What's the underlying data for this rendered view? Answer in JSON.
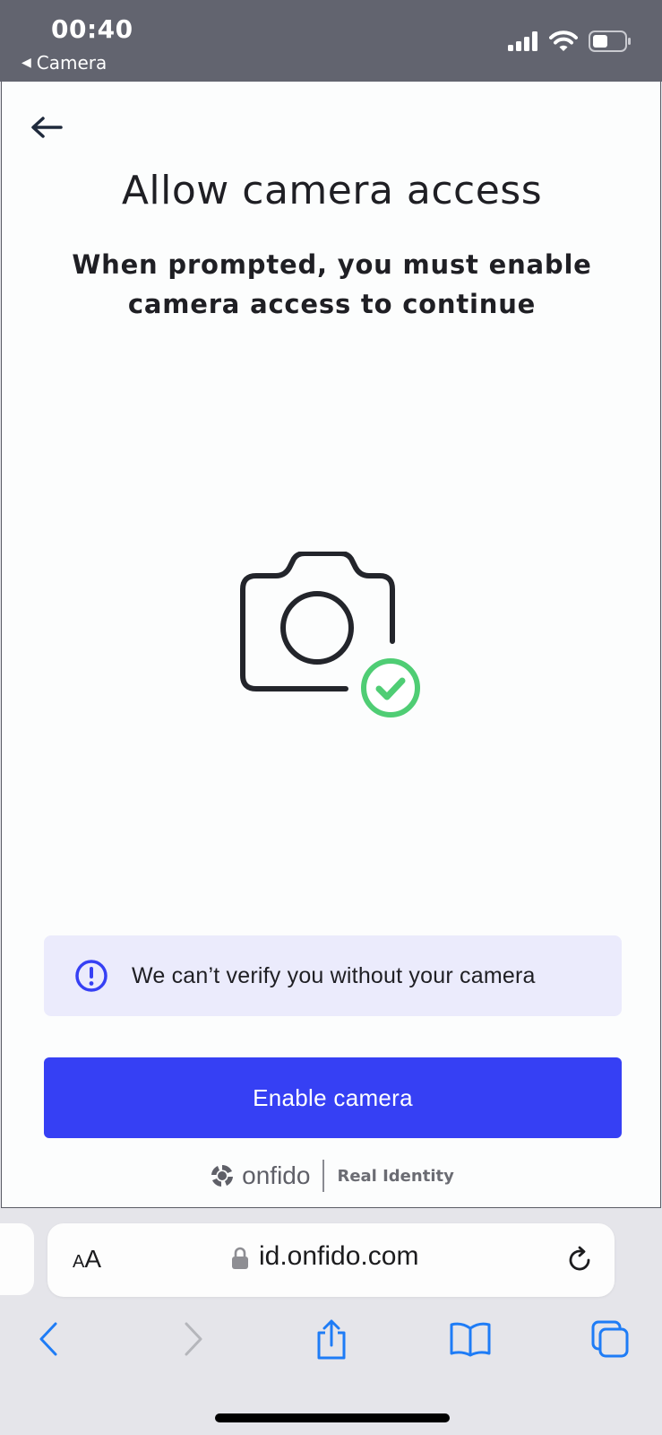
{
  "status_bar": {
    "time": "00:40",
    "back_app": "Camera",
    "icons": [
      "signal-icon",
      "wifi-icon",
      "battery-icon"
    ]
  },
  "page": {
    "title": "Allow camera access",
    "subtitle": "When prompted, you must enable camera access to continue",
    "notice": "We can’t verify you without your camera",
    "button": "Enable camera",
    "brand_name": "onfido",
    "brand_tagline": "Real Identity"
  },
  "browser": {
    "text_size_small": "A",
    "text_size_large": "A",
    "url": "id.onfido.com"
  },
  "colors": {
    "accent": "#3640f4",
    "success": "#4fcd74",
    "notice_bg": "#ebebfc",
    "status_bar": "#62646f",
    "ios_blue": "#1e7cf6"
  }
}
